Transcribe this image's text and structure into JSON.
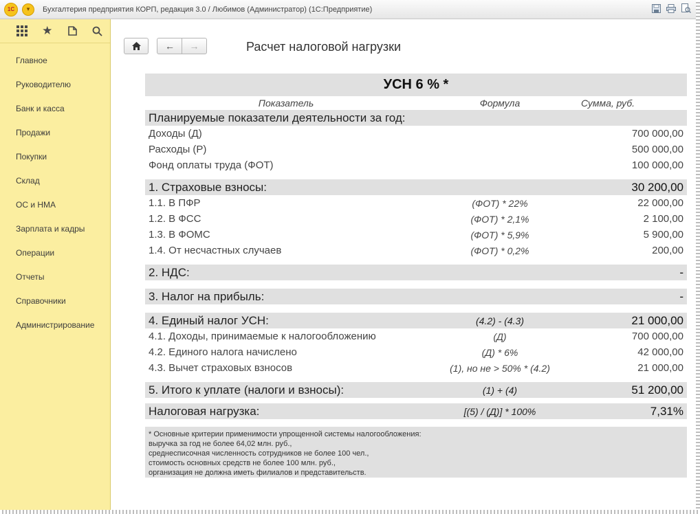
{
  "window": {
    "title": "Бухгалтерия предприятия КОРП, редакция 3.0 / Любимов (Администратор)  (1С:Предприятие)",
    "logo_text": "1С"
  },
  "sidebar": {
    "items": [
      {
        "label": "Главное"
      },
      {
        "label": "Руководителю"
      },
      {
        "label": "Банк и касса"
      },
      {
        "label": "Продажи"
      },
      {
        "label": "Покупки"
      },
      {
        "label": "Склад"
      },
      {
        "label": "ОС и НМА"
      },
      {
        "label": "Зарплата и кадры"
      },
      {
        "label": "Операции"
      },
      {
        "label": "Отчеты"
      },
      {
        "label": "Справочники"
      },
      {
        "label": "Администрирование"
      }
    ]
  },
  "page": {
    "title": "Расчет налоговой нагрузки"
  },
  "report": {
    "title": "УСН 6 % *",
    "headers": {
      "indicator": "Показатель",
      "formula": "Формула",
      "sum": "Сумма, руб."
    },
    "planned": {
      "label": "Планируемые показатели деятельности за год:",
      "rows": [
        {
          "label": "Доходы (Д)",
          "formula": "",
          "sum": "700 000,00"
        },
        {
          "label": "Расходы (Р)",
          "formula": "",
          "sum": "500 000,00"
        },
        {
          "label": "Фонд оплаты труда (ФОТ)",
          "formula": "",
          "sum": "100 000,00"
        }
      ]
    },
    "insurance": {
      "label": "1. Страховые взносы:",
      "sum": "30 200,00",
      "rows": [
        {
          "label": "1.1. В ПФР",
          "formula": "(ФОТ) * 22%",
          "sum": "22 000,00"
        },
        {
          "label": "1.2. В ФСС",
          "formula": "(ФОТ) * 2,1%",
          "sum": "2 100,00"
        },
        {
          "label": "1.3. В ФОМС",
          "formula": "(ФОТ) * 5,9%",
          "sum": "5 900,00"
        },
        {
          "label": "1.4. От несчастных случаев",
          "formula": "(ФОТ) * 0,2%",
          "sum": "200,00"
        }
      ]
    },
    "vat": {
      "label": "2. НДС:",
      "sum": "-"
    },
    "profit": {
      "label": "3. Налог на прибыль:",
      "sum": "-"
    },
    "usn": {
      "label": "4. Единый налог УСН:",
      "formula": "(4.2) - (4.3)",
      "sum": "21 000,00",
      "rows": [
        {
          "label": "4.1. Доходы, принимаемые к налогообложению",
          "formula": "(Д)",
          "sum": "700 000,00"
        },
        {
          "label": "4.2. Единого налога начислено",
          "formula": "(Д) * 6%",
          "sum": "42 000,00"
        },
        {
          "label": "4.3. Вычет страховых взносов",
          "formula": "(1), но не > 50% * (4.2)",
          "sum": "21 000,00"
        }
      ]
    },
    "total": {
      "label": "5. Итого к уплате (налоги и взносы):",
      "formula": "(1) + (4)",
      "sum": "51 200,00"
    },
    "burden": {
      "label": "Налоговая нагрузка:",
      "formula": "[(5) / (Д)] * 100%",
      "sum": "7,31%"
    },
    "note": [
      "* Основные критерии применимости упрощенной системы налогообложения:",
      "выручка за год не более 64,02 млн. руб.,",
      "среднесписочная численность сотрудников не более 100 чел.,",
      "стоимость основных средств не более 100 млн. руб.,",
      "организация не должна иметь филиалов и представительств."
    ]
  }
}
